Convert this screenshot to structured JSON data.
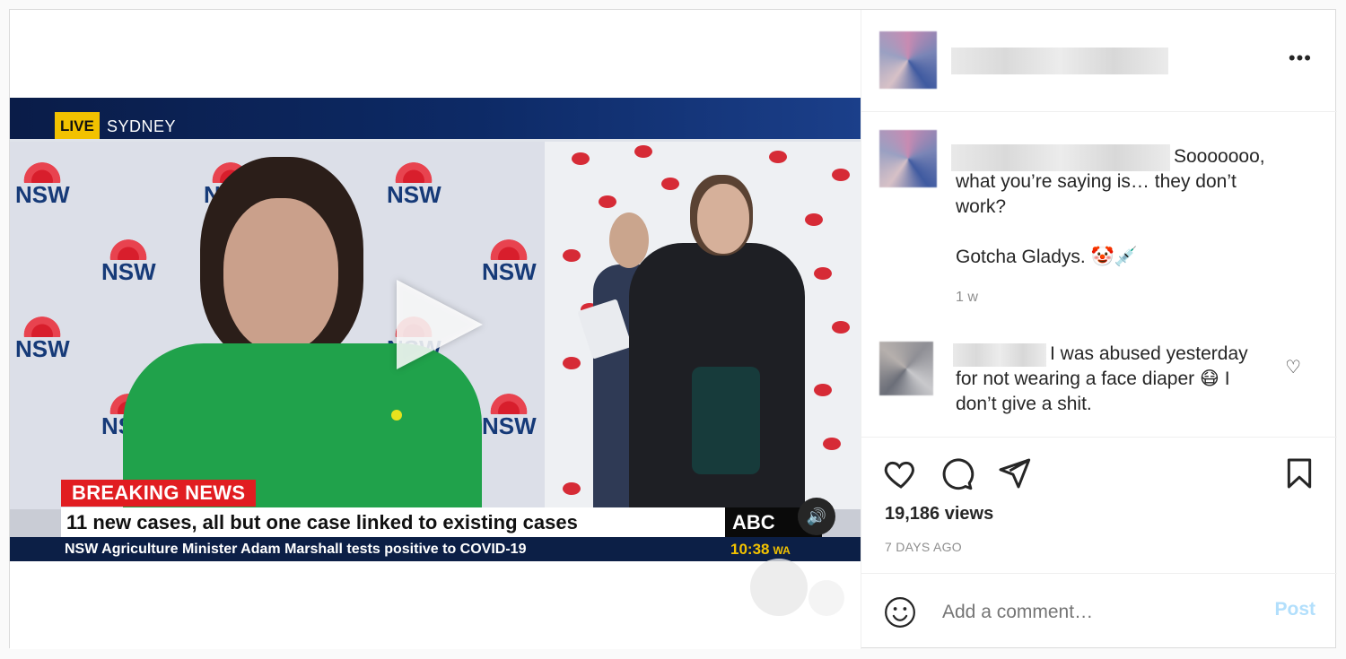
{
  "video": {
    "live_label": "LIVE",
    "location": "SYDNEY",
    "logo_text": "NSW",
    "breaking_label": "BREAKING NEWS",
    "headline": "11 new cases, all but one case linked to existing cases",
    "ticker": "NSW Agriculture Minister Adam Marshall tests positive to COVID-19",
    "brand": "ABC NEWS",
    "clock_time": "10:38",
    "clock_zone": "WA"
  },
  "header": {
    "more_glyph": "•••"
  },
  "comments": [
    {
      "text_line1": "Sooooooo,",
      "text_line2": "what you’re saying is… they don’t",
      "text_line3": "work?",
      "text_line4": "Gotcha Gladys. 🤡💉",
      "time": "1 w"
    },
    {
      "text_line1": "I was abused yesterday",
      "text_line2": "for not wearing a face diaper 😷 I",
      "text_line3": "don’t give a shit."
    }
  ],
  "stats": {
    "views": "19,186 views",
    "posted": "7 DAYS AGO"
  },
  "add_comment": {
    "placeholder": "Add a comment…",
    "post_label": "Post"
  },
  "colors": {
    "accent": "#0095f6",
    "post_disabled": "#b2dffc",
    "breaking_red": "#e11d21",
    "live_yellow": "#f2c200"
  }
}
